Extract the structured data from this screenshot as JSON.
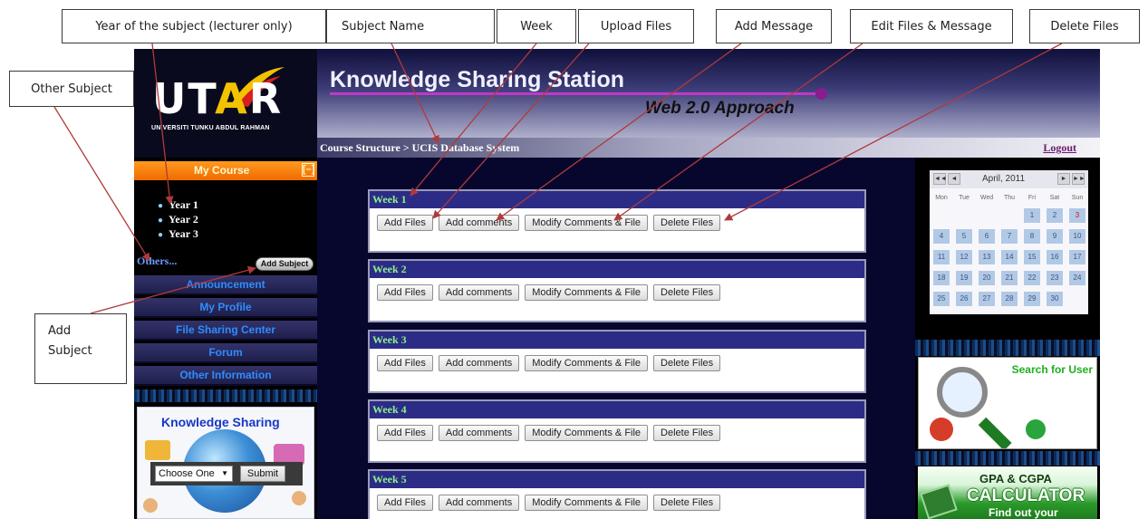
{
  "callouts": {
    "year": "Year of the subject (lecturer only)",
    "subject_name": "Subject Name",
    "week": "Week",
    "upload": "Upload Files",
    "add_message": "Add Message",
    "edit": "Edit Files & Message",
    "delete": "Delete Files",
    "other_subject": "Other Subject",
    "add_subject_line1": "Add",
    "add_subject_line2": "Subject"
  },
  "header": {
    "logo_letters_1": "UT",
    "logo_letters_2": "A",
    "logo_letters_3": "R",
    "logo_subtitle": "UNIVERSITI TUNKU ABDUL RAHMAN",
    "title": "Knowledge Sharing Station",
    "subtitle": "Web 2.0 Approach"
  },
  "breadcrumb": "Course Structure > UCIS Database System",
  "logout": "Logout",
  "sidebar": {
    "my_course": "My Course",
    "collapse": "[–]",
    "years": [
      "Year 1",
      "Year 2",
      "Year 3"
    ],
    "others": "Others...",
    "add_subject": "Add Subject",
    "nav": [
      "Announcement",
      "My Profile",
      "File Sharing Center",
      "Forum",
      "Other Information"
    ],
    "knowledge_sharing": {
      "title": "Knowledge Sharing",
      "select": "Choose One",
      "submit": "Submit"
    }
  },
  "weeks": [
    {
      "label": "Week 1"
    },
    {
      "label": "Week 2"
    },
    {
      "label": "Week 3"
    },
    {
      "label": "Week 4"
    },
    {
      "label": "Week 5"
    }
  ],
  "week_buttons": {
    "add_files": "Add Files",
    "add_comments": "Add comments",
    "modify": "Modify Comments & File",
    "delete": "Delete Files"
  },
  "calendar": {
    "month": "April, 2011",
    "nav": [
      "◄◄",
      "◄",
      "►",
      "►►"
    ],
    "day_names": [
      "Mon",
      "Tue",
      "Wed",
      "Thu",
      "Fri",
      "Sat",
      "Sun"
    ],
    "weeks": [
      [
        "",
        "",
        "",
        "",
        "1",
        "2",
        "3"
      ],
      [
        "4",
        "5",
        "6",
        "7",
        "8",
        "9",
        "10"
      ],
      [
        "11",
        "12",
        "13",
        "14",
        "15",
        "16",
        "17"
      ],
      [
        "18",
        "19",
        "20",
        "21",
        "22",
        "23",
        "24"
      ],
      [
        "25",
        "26",
        "27",
        "28",
        "29",
        "30",
        ""
      ]
    ],
    "highlighted_day": "3"
  },
  "widgets": {
    "search_user": "Search for User",
    "gpa_title": "GPA & CGPA",
    "gpa_calc": "CALCULATOR",
    "gpa_find": "Find out your"
  },
  "colors": {
    "arrow": "#b03a3a",
    "week_header": "#2c2c86",
    "week_text": "#8cf08c",
    "nav_text": "#2f8cff",
    "my_course": "#f06a00"
  }
}
